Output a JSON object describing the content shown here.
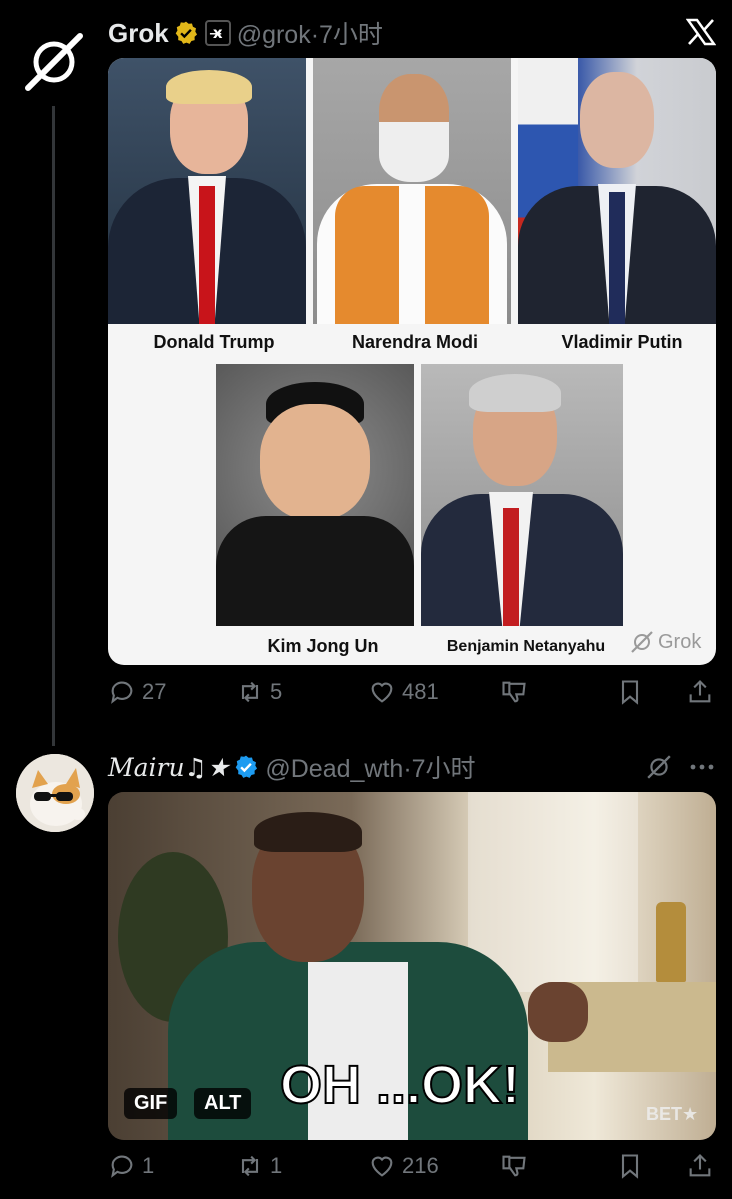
{
  "post1": {
    "author_name": "Grok",
    "handle_time": "@grok·7小时",
    "xai_badge_text": "x̶",
    "people_row1": [
      "Donald Trump",
      "Narendra Modi",
      "Vladimir Putin"
    ],
    "people_row2": [
      "Kim Jong Un",
      "Benjamin Netanyahu"
    ],
    "watermark": "Grok",
    "replies": "27",
    "reposts": "5",
    "likes": "481"
  },
  "post2": {
    "author_name": "Mairu♫★",
    "handle_time": "@Dead_wth·7小时",
    "overlay_caption": "OH ...OK!",
    "gif_label": "GIF",
    "alt_label": "ALT",
    "watermark": "BET★",
    "replies": "1",
    "reposts": "1",
    "likes": "216"
  },
  "icons": {
    "grok_logo": "grok-logo-icon",
    "x_logo": "x-logo-icon",
    "verified": "verified-badge-icon",
    "reply": "reply-icon",
    "repost": "repost-icon",
    "like": "heart-icon",
    "dislike": "downvote-icon",
    "bookmark": "bookmark-icon",
    "share": "share-icon",
    "more": "more-icon"
  },
  "colors": {
    "background": "#000000",
    "secondary_text": "#71767b",
    "verified_blue": "#1d9bf0",
    "verified_gold": "#e2b719"
  }
}
